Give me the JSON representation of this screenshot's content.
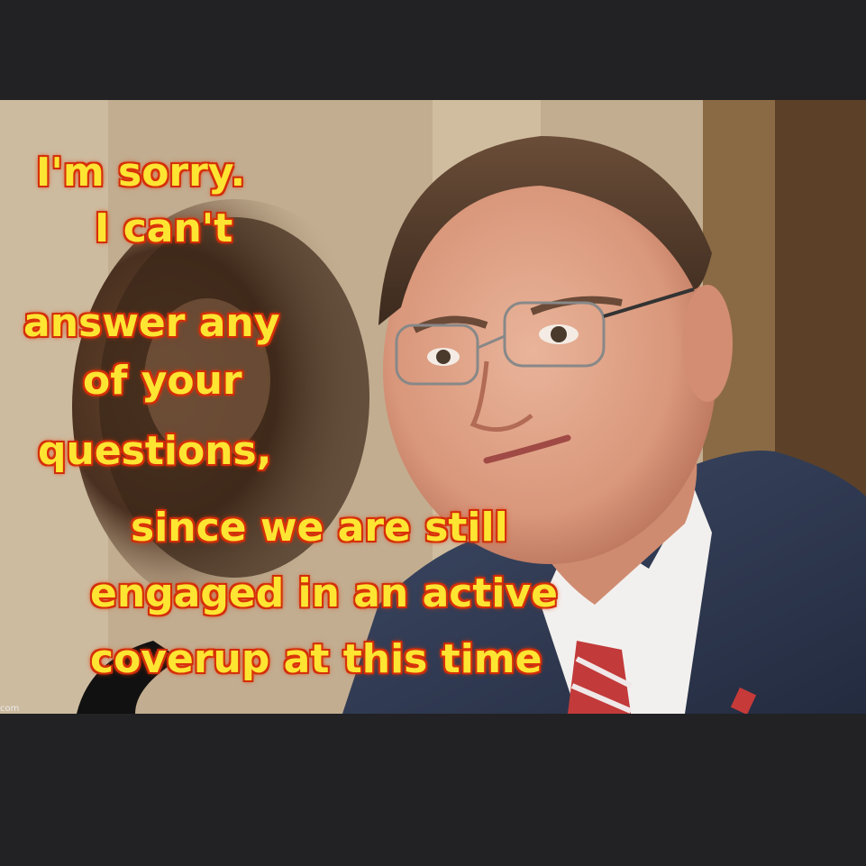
{
  "caption": {
    "line1": "I'm sorry.",
    "line2": "I can't",
    "line3": "answer any",
    "line4": "of your",
    "line5": "questions,",
    "line6": "since we are still",
    "line7": "engaged in an active",
    "line8": "coverup at this time"
  },
  "watermark": "com",
  "colors": {
    "frame": "#222224",
    "caption_fill": "#fde532",
    "caption_glow": "#e23a0c"
  }
}
